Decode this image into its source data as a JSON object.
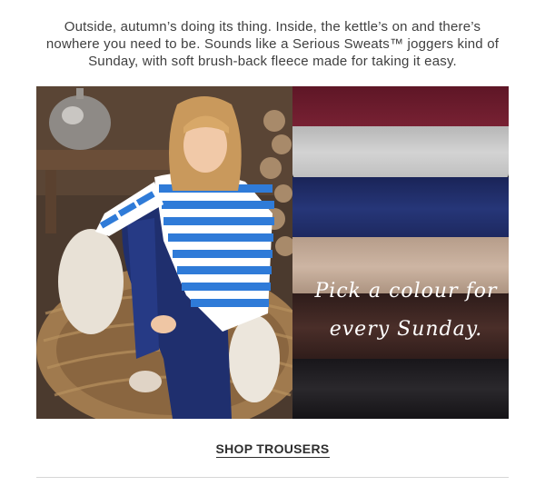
{
  "intro": {
    "text": "Outside, autumn’s doing its thing. Inside, the kettle’s on and there’s nowhere you need to be. Sounds like a Serious Sweats™ joggers kind of Sunday, with soft brush-back fleece made for taking it easy."
  },
  "hero": {
    "left_image_alt": "Woman in a blue and white striped jumper and navy joggers sitting in a wicker chair",
    "right_image_alt": "Stack of folded joggers in burgundy, grey, navy, beige, brown and black",
    "script_line1": "Pick a colour for",
    "script_line2": "every Sunday.",
    "fold_colors": [
      "#6b1c2c",
      "#c9c9c9",
      "#22306a",
      "#c8b09f",
      "#3a2421",
      "#1d1b1e"
    ]
  },
  "cta": {
    "label": "SHOP TROUSERS"
  }
}
